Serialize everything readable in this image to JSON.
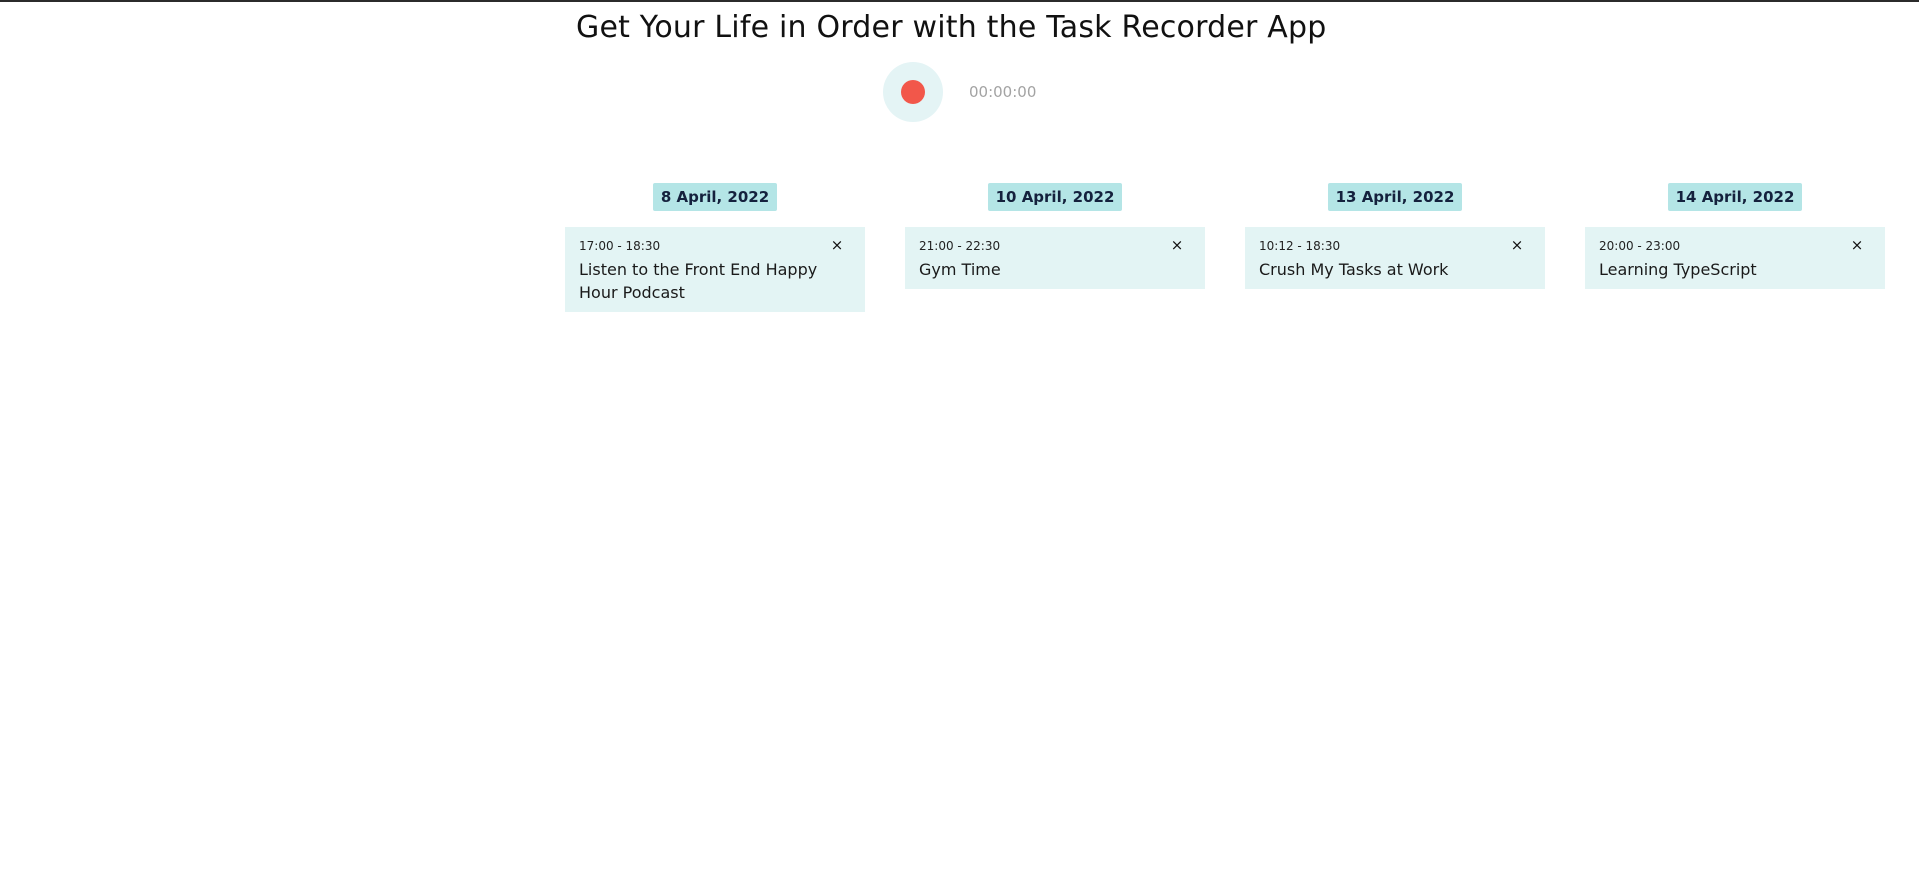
{
  "header": {
    "title": "Get Your Life in Order with the Task Recorder App"
  },
  "recorder": {
    "record_icon": "record-dot-icon",
    "record_color": "#f2574a",
    "timer": "00:00:00"
  },
  "days": [
    {
      "date": "8 April, 2022",
      "tasks": [
        {
          "time": "17:00 - 18:30",
          "description": "Listen to the Front End Happy Hour Podcast",
          "delete_icon": "close-icon",
          "delete_label": "×"
        }
      ]
    },
    {
      "date": "10 April, 2022",
      "tasks": [
        {
          "time": "21:00 - 22:30",
          "description": "Gym Time",
          "delete_icon": "close-icon",
          "delete_label": "×"
        }
      ]
    },
    {
      "date": "13 April, 2022",
      "tasks": [
        {
          "time": "10:12 - 18:30",
          "description": "Crush My Tasks at Work",
          "delete_icon": "close-icon",
          "delete_label": "×"
        }
      ]
    },
    {
      "date": "14 April, 2022",
      "tasks": [
        {
          "time": "20:00 - 23:00",
          "description": "Learning TypeScript",
          "delete_icon": "close-icon",
          "delete_label": "×"
        }
      ]
    }
  ],
  "colors": {
    "date_badge": "#b4e5e6",
    "task_card": "#e3f4f4",
    "record_button_bg": "#e4f4f5"
  }
}
